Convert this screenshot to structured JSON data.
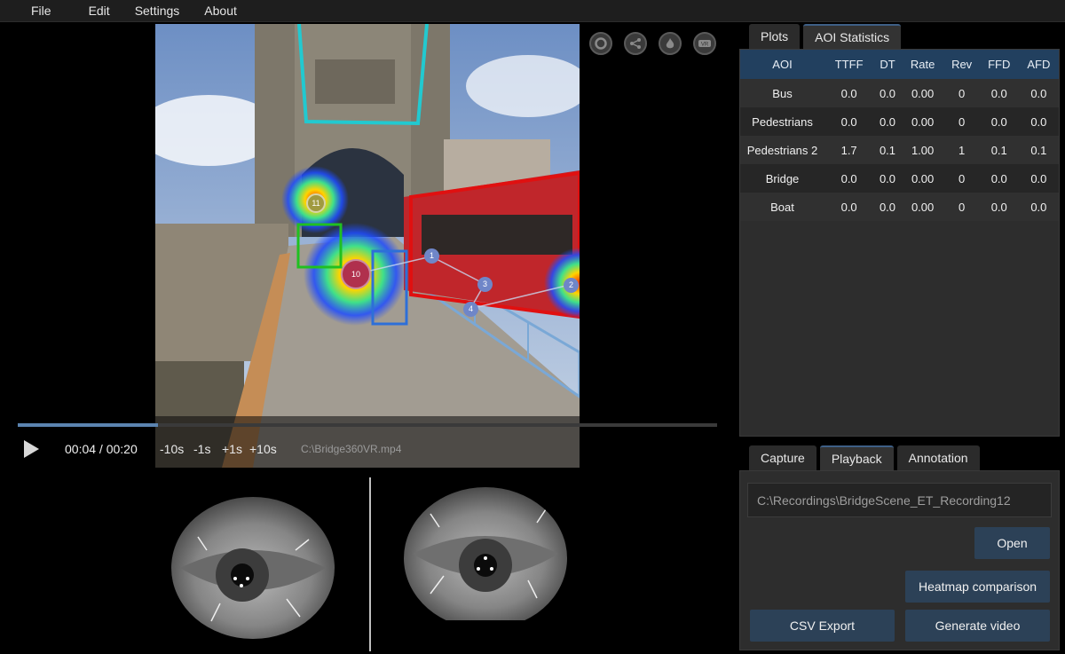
{
  "menu": [
    "File",
    "Edit",
    "Settings",
    "About"
  ],
  "video": {
    "fixations": [
      "11",
      "10",
      "1",
      "2",
      "3",
      "4"
    ],
    "overlay_icons": [
      "record-icon",
      "share-icon",
      "heatmap-flame-icon",
      "vr-headset-icon"
    ]
  },
  "playback": {
    "progress": 0.2,
    "time": "00:04 / 00:20",
    "skips": [
      "-10s",
      "-1s",
      "+1s",
      "+10s"
    ],
    "filename": "C:\\Bridge360VR.mp4"
  },
  "top_tabs": [
    "Plots",
    "AOI Statistics"
  ],
  "stats": {
    "columns": [
      "AOI",
      "TTFF",
      "DT",
      "Rate",
      "Rev",
      "FFD",
      "AFD"
    ],
    "rows": [
      [
        "Bus",
        "0.0",
        "0.0",
        "0.00",
        "0",
        "0.0",
        "0.0"
      ],
      [
        "Pedestrians",
        "0.0",
        "0.0",
        "0.00",
        "0",
        "0.0",
        "0.0"
      ],
      [
        "Pedestrians 2",
        "1.7",
        "0.1",
        "1.00",
        "1",
        "0.1",
        "0.1"
      ],
      [
        "Bridge",
        "0.0",
        "0.0",
        "0.00",
        "0",
        "0.0",
        "0.0"
      ],
      [
        "Boat",
        "0.0",
        "0.0",
        "0.00",
        "0",
        "0.0",
        "0.0"
      ]
    ]
  },
  "bottom_tabs": [
    "Capture",
    "Playback",
    "Annotation"
  ],
  "recording": {
    "path": "C:\\Recordings\\BridgeScene_ET_Recording12",
    "open": "Open",
    "heatmap": "Heatmap comparison",
    "csv": "CSV Export",
    "generate": "Generate video"
  },
  "colors": {
    "accent": "#3e5f86",
    "header": "#22405f",
    "button": "#2c4157"
  }
}
